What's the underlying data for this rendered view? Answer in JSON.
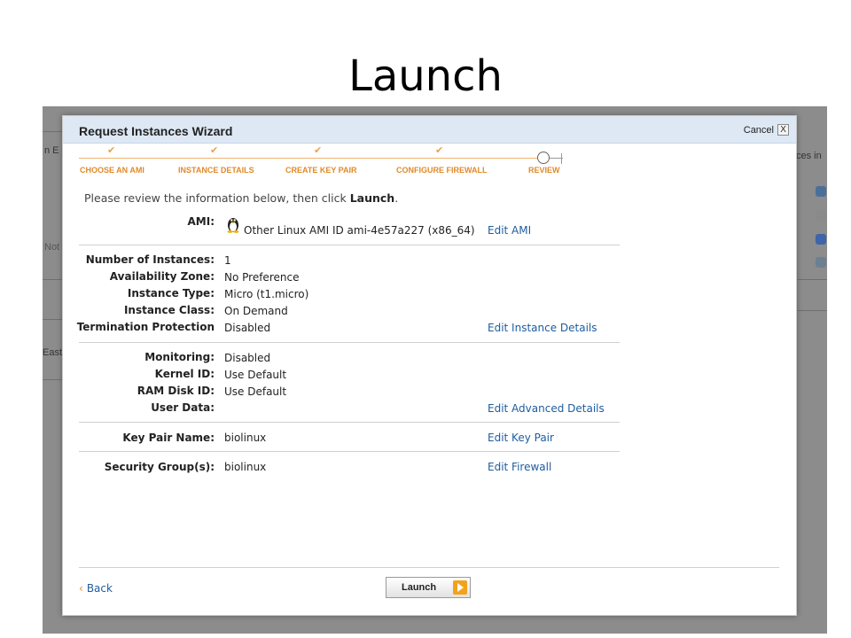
{
  "slide_title": "Launch",
  "background_fragments": {
    "left_top": "n E",
    "left_mid": "Not",
    "left_low": "East",
    "right_top": "ces in"
  },
  "wizard": {
    "title": "Request Instances Wizard",
    "cancel_label": "Cancel",
    "close_glyph": "X",
    "steps": [
      {
        "label": "CHOOSE AN AMI",
        "state": "done"
      },
      {
        "label": "INSTANCE DETAILS",
        "state": "done"
      },
      {
        "label": "CREATE KEY PAIR",
        "state": "done"
      },
      {
        "label": "CONFIGURE FIREWALL",
        "state": "done"
      },
      {
        "label": "REVIEW",
        "state": "current"
      }
    ],
    "check_glyph": "✔",
    "intro_prefix": "Please review the information below, then click ",
    "intro_bold": "Launch",
    "intro_suffix": ".",
    "ami": {
      "label": "AMI:",
      "value": "Other Linux AMI ID ami-4e57a227 (x86_64)",
      "edit": "Edit AMI",
      "icon": "linux-tux-icon"
    },
    "instance_details": {
      "rows": [
        {
          "label": "Number of Instances:",
          "value": "1"
        },
        {
          "label": "Availability Zone:",
          "value": "No Preference"
        },
        {
          "label": "Instance Type:",
          "value": "Micro (t1.micro)"
        },
        {
          "label": "Instance Class:",
          "value": "On Demand"
        },
        {
          "label": "Termination Protection",
          "value": "Disabled"
        }
      ],
      "edit": "Edit Instance Details"
    },
    "advanced_details": {
      "rows": [
        {
          "label": "Monitoring:",
          "value": "Disabled"
        },
        {
          "label": "Kernel ID:",
          "value": "Use Default"
        },
        {
          "label": "RAM Disk ID:",
          "value": "Use Default"
        },
        {
          "label": "User Data:",
          "value": ""
        }
      ],
      "edit": "Edit Advanced Details"
    },
    "key_pair": {
      "label": "Key Pair Name:",
      "value": "biolinux",
      "edit": "Edit Key Pair"
    },
    "security": {
      "label": "Security Group(s):",
      "value": "biolinux",
      "edit": "Edit Firewall"
    },
    "footer": {
      "back_arrow": "‹",
      "back_label": "Back",
      "launch_label": "Launch"
    }
  },
  "colors": {
    "accent_orange": "#e08a2a",
    "link_blue": "#1e5c9e",
    "header_bg": "#dde8f4",
    "overlay_gray": "#8c8c8c"
  }
}
